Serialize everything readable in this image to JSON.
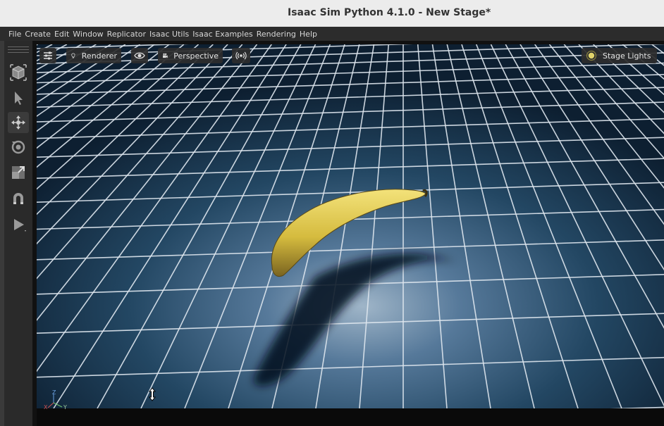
{
  "window": {
    "title": "Isaac Sim Python 4.1.0 - New Stage*"
  },
  "menu": [
    "File",
    "Create",
    "Edit",
    "Window",
    "Replicator",
    "Isaac Utils",
    "Isaac Examples",
    "Rendering",
    "Help"
  ],
  "toolbar": {
    "tools": [
      "viewport-select-mode-icon",
      "select-arrow-icon",
      "move-icon",
      "rotate-icon",
      "scale-icon",
      "snap-magnet-icon",
      "play-icon"
    ],
    "active_tool": "move-icon"
  },
  "viewport_menu": {
    "settings_icon": "sliders-icon",
    "renderer_label": "Renderer",
    "renderer_icon": "lightbulb-icon",
    "visibility_icon": "eye-icon",
    "camera_label": "Perspective",
    "camera_icon": "movie-camera-icon",
    "audio_icon": "broadcast-icon",
    "lights_label": "Stage Lights",
    "lights_icon": "sun-icon"
  },
  "scene": {
    "object": "banana",
    "ground": "grid"
  },
  "axis_gizmo": {
    "z": "Z",
    "x": "X",
    "y": "Y"
  },
  "colors": {
    "titlebar": "#ececec",
    "menubar": "#2c2c2c",
    "grid_line": "#dfe7ef",
    "banana": "#d8c24a"
  }
}
